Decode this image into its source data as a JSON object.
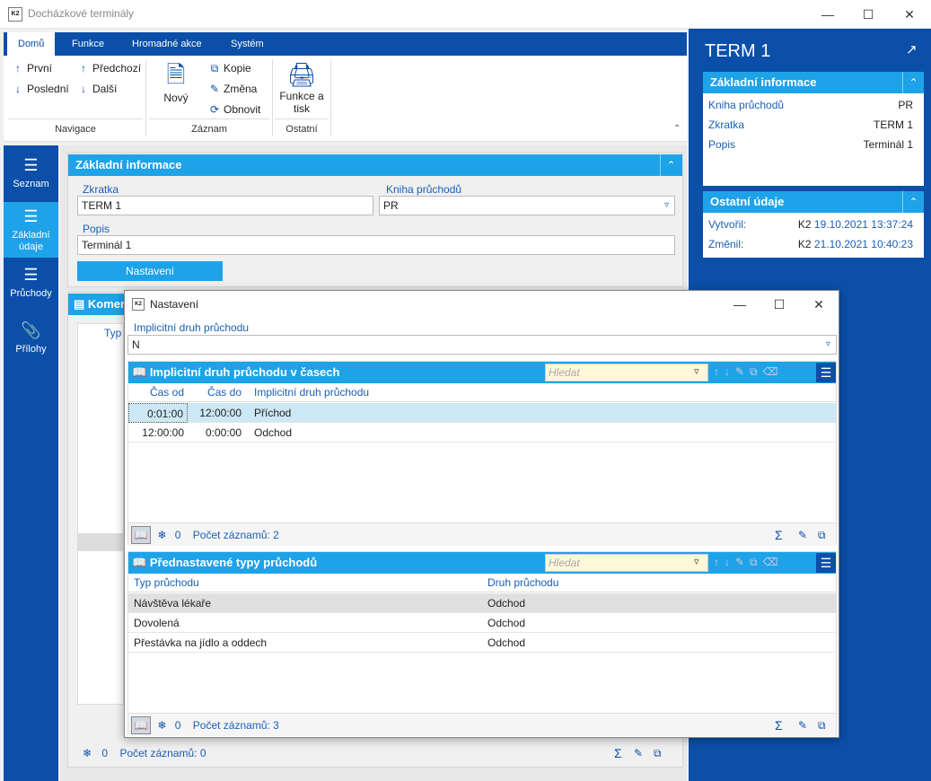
{
  "window": {
    "title": "Docházkové terminály",
    "app_logo": "K2",
    "min_icon": "minimize-icon",
    "max_icon": "maximize-icon",
    "close_icon": "close-icon"
  },
  "ribbon": {
    "tabs": [
      "Domů",
      "Funkce",
      "Hromadné akce",
      "Systém"
    ],
    "nav": {
      "first": "První",
      "prev": "Předchozí",
      "last": "Poslední",
      "next": "Další",
      "group": "Navigace"
    },
    "record": {
      "new": "Nový",
      "copy": "Kopie",
      "change": "Změna",
      "refresh": "Obnovit",
      "group": "Záznam"
    },
    "other": {
      "print": "Funkce a tisk",
      "group": "Ostatní"
    }
  },
  "leftnav": {
    "items": [
      "Seznam",
      "Základní údaje",
      "Průchody",
      "Přílohy"
    ]
  },
  "main": {
    "section_title": "Základní informace",
    "zkratka_label": "Zkratka",
    "zkratka_value": "TERM 1",
    "kniha_label": "Kniha průchodů",
    "kniha_value": "PR",
    "popis_label": "Popis",
    "popis_value": "Terminál 1",
    "settings_button": "Nastavení",
    "komentar_title": "Komer",
    "komentar_col": "Typ",
    "footer_count": "0",
    "footer_text": "Počet záznamů: 0"
  },
  "right": {
    "title": "TERM 1",
    "basic_title": "Základní informace",
    "basic_rows": [
      {
        "key": "Kniha průchodů",
        "value": "PR"
      },
      {
        "key": "Zkratka",
        "value": "TERM 1"
      },
      {
        "key": "Popis",
        "value": "Terminál 1"
      }
    ],
    "other_title": "Ostatní údaje",
    "created_label": "Vytvořil:",
    "created_user": "K2",
    "created_date": "19.10.2021 13:37:24",
    "changed_label": "Změnil:",
    "changed_user": "K2",
    "changed_date": "21.10.2021 10:40:23"
  },
  "dialog": {
    "title": "Nastavení",
    "default_label": "Implicitní druh průchodu",
    "default_value": "N",
    "grid1": {
      "title": "Implicitní druh průchodu v časech",
      "search_placeholder": "Hledat",
      "columns": [
        "Čas od",
        "Čas do",
        "Implicitní druh průchodu"
      ],
      "rows": [
        [
          "0:01:00",
          "12:00:00",
          "Příchod"
        ],
        [
          "12:00:00",
          "0:00:00",
          "Odchod"
        ]
      ],
      "count": "0",
      "status": "Počet záznamů: 2"
    },
    "grid2": {
      "title": "Přednastavené typy průchodů",
      "search_placeholder": "Hledat",
      "columns": [
        "Typ průchodu",
        "Druh průchodu"
      ],
      "rows": [
        [
          "Návštěva lékaře",
          "Odchod"
        ],
        [
          "Dovolená",
          "Odchod"
        ],
        [
          "Přestávka na jídlo a oddech",
          "Odchod"
        ]
      ],
      "count": "0",
      "status": "Počet záznamů: 3"
    }
  },
  "colors": {
    "nav_blue": "#0b4fa8",
    "accent": "#1ea2e8",
    "label_blue": "#1a5fb4",
    "search_bg": "#fff8d8"
  }
}
